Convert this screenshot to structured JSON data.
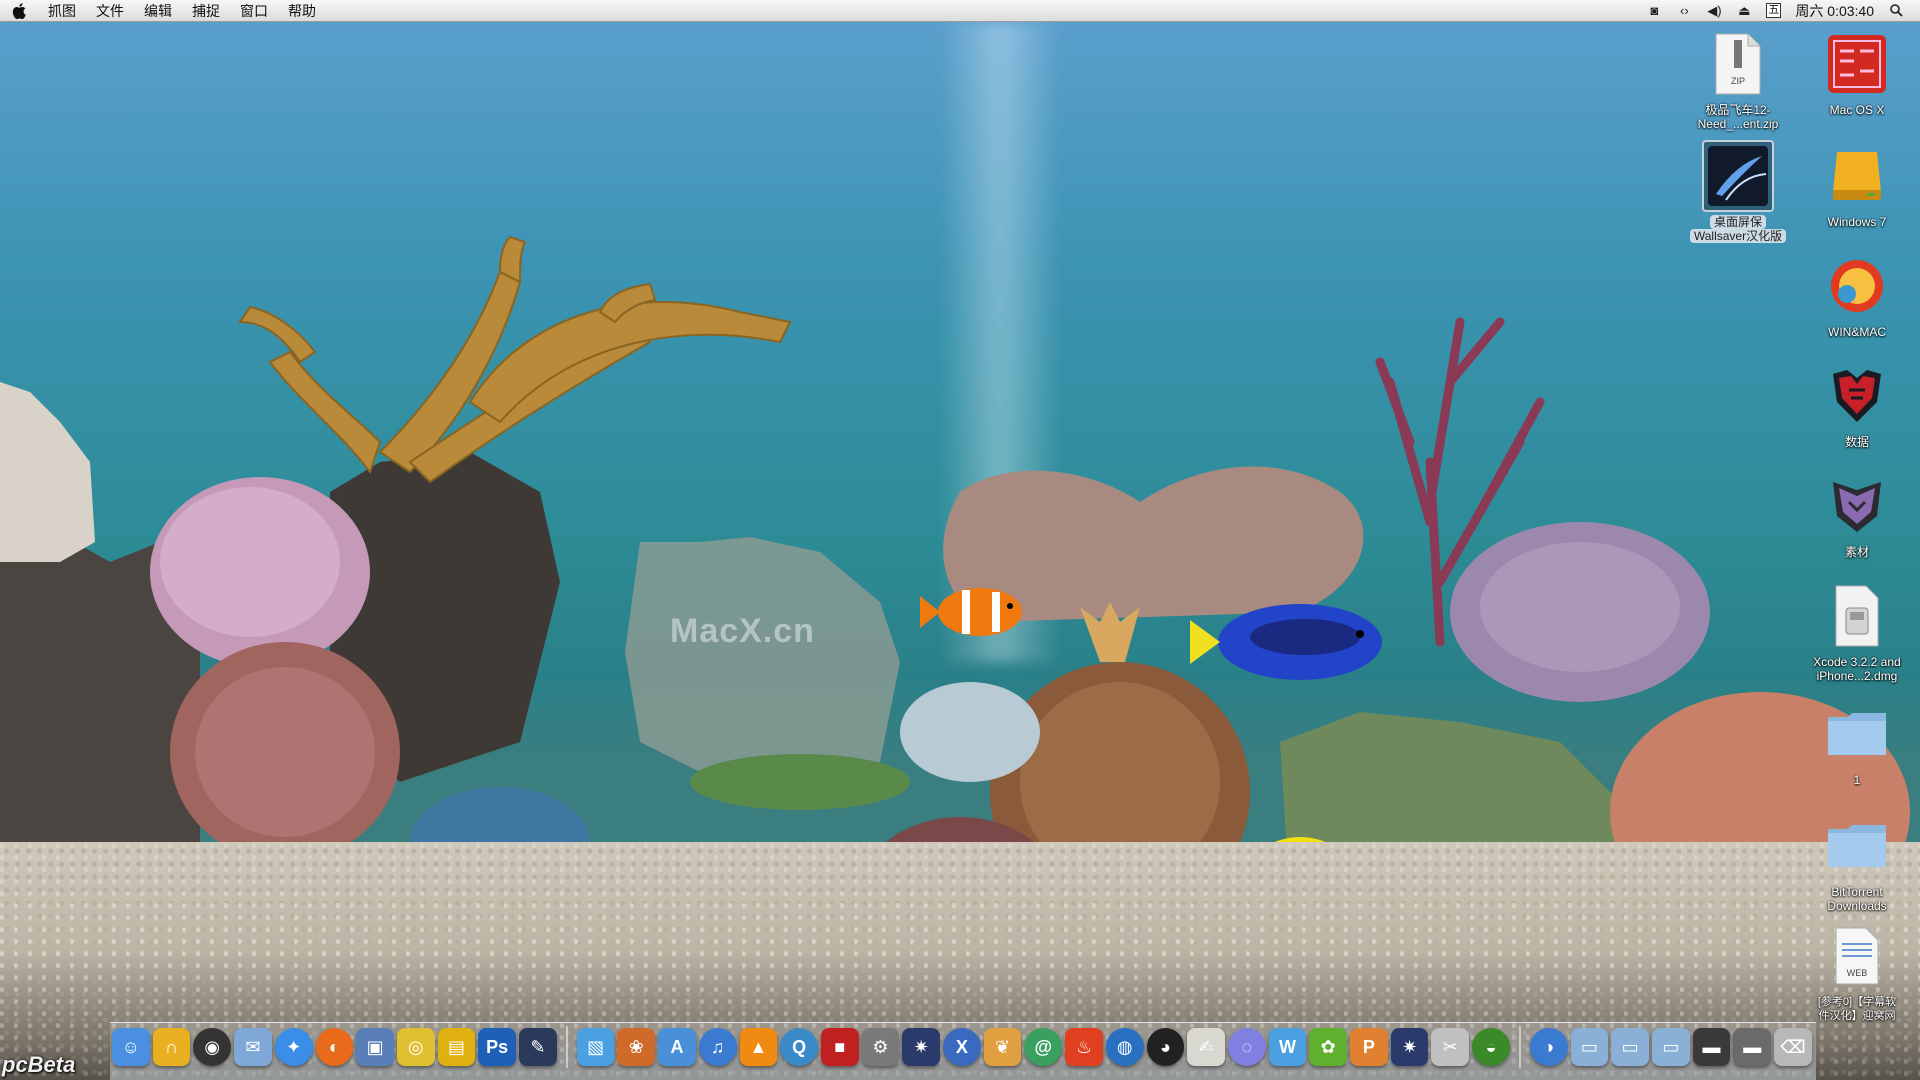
{
  "menubar": {
    "items": [
      "抓图",
      "文件",
      "编辑",
      "捕捉",
      "窗口",
      "帮助"
    ],
    "ime_label": "五",
    "clock": "周六 0:03:40"
  },
  "desktop": {
    "watermark": "MacX.cn",
    "corner_watermark": "pcBeta",
    "icons": [
      {
        "label1": "极品飞车12-",
        "label2": "Need_...ent.zip",
        "badge": "ZIP"
      },
      {
        "label1": "Mac OS X",
        "label2": ""
      },
      {
        "label1": "桌面屏保",
        "label2": "Wallsaver汉化版"
      },
      {
        "label1": "Windows 7",
        "label2": ""
      },
      {
        "label1": "WIN&MAC",
        "label2": ""
      },
      {
        "label1": "数据",
        "label2": ""
      },
      {
        "label1": "素材",
        "label2": ""
      },
      {
        "label1": "Xcode 3.2.2 and",
        "label2": "iPhone...2.dmg"
      },
      {
        "label1": "1",
        "label2": ""
      },
      {
        "label1": "BitTorrent",
        "label2": "Downloads"
      },
      {
        "label1": "[参考0]【字幕软",
        "label2": "件汉化】迎窝网",
        "badge": "WEB"
      }
    ]
  },
  "dock": {
    "apps": [
      {
        "name": "finder",
        "glyph": "☺",
        "color": "#4a8fe0"
      },
      {
        "name": "magnet",
        "glyph": "∩",
        "color": "#e8b020"
      },
      {
        "name": "dashboard",
        "glyph": "◉",
        "color": "#333333"
      },
      {
        "name": "mail-stamp",
        "glyph": "✉",
        "color": "#7fa8d8"
      },
      {
        "name": "safari",
        "glyph": "✦",
        "color": "#3a8ee8"
      },
      {
        "name": "firefox",
        "glyph": "◐",
        "color": "#e86a1a"
      },
      {
        "name": "preview",
        "glyph": "▣",
        "color": "#5a7fb8"
      },
      {
        "name": "eye",
        "glyph": "◎",
        "color": "#e0c030"
      },
      {
        "name": "drive",
        "glyph": "▤",
        "color": "#e0b010"
      },
      {
        "name": "photoshop",
        "glyph": "Ps",
        "color": "#1e5fb8"
      },
      {
        "name": "pen",
        "glyph": "✎",
        "color": "#2a3a5a"
      },
      {
        "name": "snapshot",
        "glyph": "▧",
        "color": "#4aa0e0"
      },
      {
        "name": "photos",
        "glyph": "❀",
        "color": "#d06a2a"
      },
      {
        "name": "appstore",
        "glyph": "A",
        "color": "#4a90d8"
      },
      {
        "name": "itunes",
        "glyph": "♫",
        "color": "#3a7ad0"
      },
      {
        "name": "vlc",
        "glyph": "▲",
        "color": "#f08a10"
      },
      {
        "name": "quicktime",
        "glyph": "Q",
        "color": "#3a8ac8"
      },
      {
        "name": "photobooth",
        "glyph": "■",
        "color": "#c02020"
      },
      {
        "name": "sysprefs",
        "glyph": "⚙",
        "color": "#7a7a7a"
      },
      {
        "name": "wallsaver",
        "glyph": "✷",
        "color": "#2a3a6a"
      },
      {
        "name": "xcode",
        "glyph": "X",
        "color": "#3a6ac0"
      },
      {
        "name": "bird",
        "glyph": "❦",
        "color": "#e0a040"
      },
      {
        "name": "swirl",
        "glyph": "@",
        "color": "#3aa060"
      },
      {
        "name": "flame",
        "glyph": "♨",
        "color": "#e04020"
      },
      {
        "name": "earth",
        "glyph": "◍",
        "color": "#2a70c0"
      },
      {
        "name": "qq",
        "glyph": "◕",
        "color": "#222222"
      },
      {
        "name": "notes",
        "glyph": "✍",
        "color": "#d8d8d0"
      },
      {
        "name": "globe",
        "glyph": "◌",
        "color": "#8080e0"
      },
      {
        "name": "wave",
        "glyph": "W",
        "color": "#4aa0e0"
      },
      {
        "name": "leaf",
        "glyph": "✿",
        "color": "#60b030"
      },
      {
        "name": "pencil2",
        "glyph": "P",
        "color": "#e08030"
      },
      {
        "name": "wallsaver2",
        "glyph": "✷",
        "color": "#2a3a6a"
      },
      {
        "name": "scissors",
        "glyph": "✂",
        "color": "#c0c0c0"
      },
      {
        "name": "frog",
        "glyph": "◒",
        "color": "#3a8a2a"
      },
      {
        "name": "network",
        "glyph": "◑",
        "color": "#3a7ad0"
      },
      {
        "name": "folder-apps",
        "glyph": "▭",
        "color": "#8ab0d8"
      },
      {
        "name": "folder-docs",
        "glyph": "▭",
        "color": "#8ab0d8"
      },
      {
        "name": "folder-down",
        "glyph": "▭",
        "color": "#8ab0d8"
      },
      {
        "name": "screen",
        "glyph": "▬",
        "color": "#3a3a3a"
      },
      {
        "name": "screen2",
        "glyph": "▬",
        "color": "#6a6a6a"
      },
      {
        "name": "trash",
        "glyph": "⌫",
        "color": "#b8b8b8"
      }
    ]
  }
}
